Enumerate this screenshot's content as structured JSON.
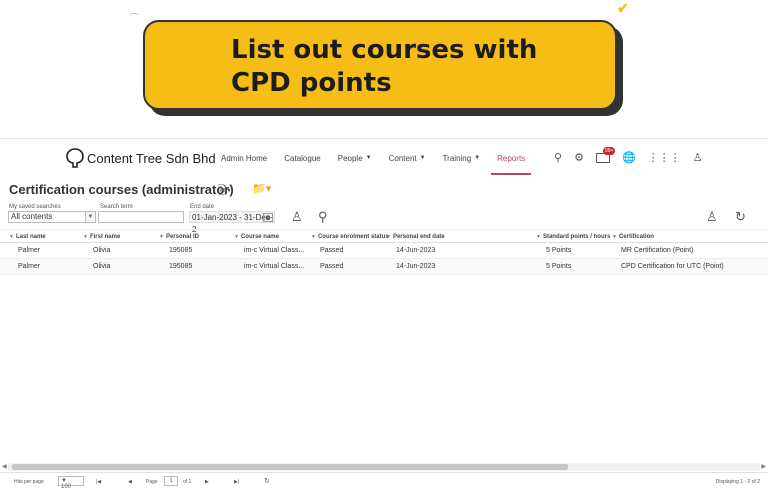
{
  "banner": {
    "line1": "List out courses with",
    "line2": "CPD points"
  },
  "brand": {
    "name": "Content Tree Sdn Bhd"
  },
  "nav": [
    {
      "label": "Admin Home",
      "caret": false
    },
    {
      "label": "Catalogue",
      "caret": false
    },
    {
      "label": "People",
      "caret": true
    },
    {
      "label": "Content",
      "caret": true
    },
    {
      "label": "Training",
      "caret": true
    },
    {
      "label": "Reports",
      "caret": false,
      "active": true
    }
  ],
  "notifications": {
    "badge": "99+"
  },
  "page": {
    "title": "Certification courses (administrator)"
  },
  "filters": {
    "saved_label": "My saved searches",
    "saved_value": "All contents",
    "search_label": "Search term",
    "search_value": "",
    "date_label": "End date",
    "date_value": "01-Jan-2023 - 31-Dec-2"
  },
  "table": {
    "columns": [
      "Last name",
      "First name",
      "Personal ID",
      "Course name",
      "Course enrolment status",
      "Personal end date",
      "Standard points / hours",
      "Certification"
    ],
    "rows": [
      [
        "Palmer",
        "Olivia",
        "195085",
        "im-c Virtual Class...",
        "Passed",
        "14-Jun-2023",
        "5 Points",
        "MR Certification (Point)"
      ],
      [
        "Palmer",
        "Olivia",
        "195085",
        "im-c Virtual Class...",
        "Passed",
        "14-Jun-2023",
        "5 Points",
        "CPD Certification for UTC (Point)"
      ]
    ]
  },
  "pager": {
    "per_page_label": "Hits per page",
    "per_page_value": "100",
    "page_label": "Page",
    "page_value": "1",
    "of_label": "of 1",
    "status": "Displaying 1 - 2 of 2"
  },
  "colors": {
    "banner": "#f6bd16",
    "active_nav": "#b64b63",
    "badge": "#c1272d"
  },
  "icons": [
    "search-icon",
    "gear-icon",
    "mail-icon",
    "globe-icon",
    "apps-grid-icon",
    "user-icon",
    "export-icon",
    "folder-icon",
    "calendar-icon",
    "user-search-icon",
    "refresh-icon"
  ]
}
